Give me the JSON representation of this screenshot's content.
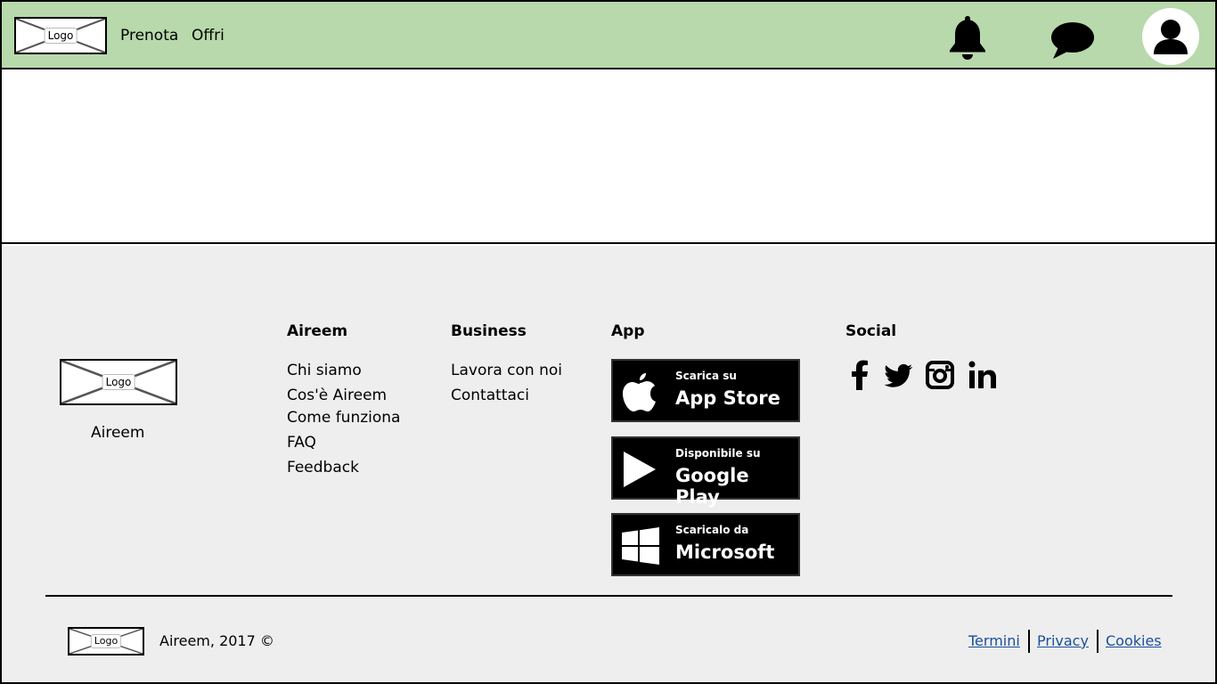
{
  "header": {
    "logo_label": "Logo",
    "nav": {
      "prenota": "Prenota",
      "offri": "Offri"
    },
    "icons": [
      "bell-icon",
      "chat-icon",
      "user-icon"
    ]
  },
  "footer": {
    "logo_label": "Logo",
    "brand": "Aireem",
    "columns": {
      "aireem": {
        "title": "Aireem",
        "links": [
          "Chi siamo",
          "Cos'è Aireem",
          "Come funziona",
          "FAQ",
          "Feedback"
        ]
      },
      "business": {
        "title": "Business",
        "links": [
          "Lavora con noi",
          "Contattaci"
        ]
      },
      "app": {
        "title": "App"
      },
      "social": {
        "title": "Social",
        "icons": [
          "facebook-icon",
          "twitter-icon",
          "instagram-icon",
          "linkedin-icon"
        ]
      }
    },
    "badges": [
      {
        "small": "Scarica su",
        "big": "App Store",
        "icon": "apple-icon"
      },
      {
        "small": "Disponibile su",
        "big": "Google Play",
        "icon": "play-icon"
      },
      {
        "small": "Scaricalo da",
        "big": "Microsoft",
        "icon": "windows-icon"
      }
    ],
    "bottom": {
      "logo_label": "Logo",
      "copyright": "Aireem, 2017 ©",
      "links": [
        "Termini",
        "Privacy",
        "Cookies"
      ]
    }
  },
  "colors": {
    "header_bg": "#b8d9ab",
    "footer_bg": "#eeeeee",
    "link": "#1a4f9c"
  }
}
